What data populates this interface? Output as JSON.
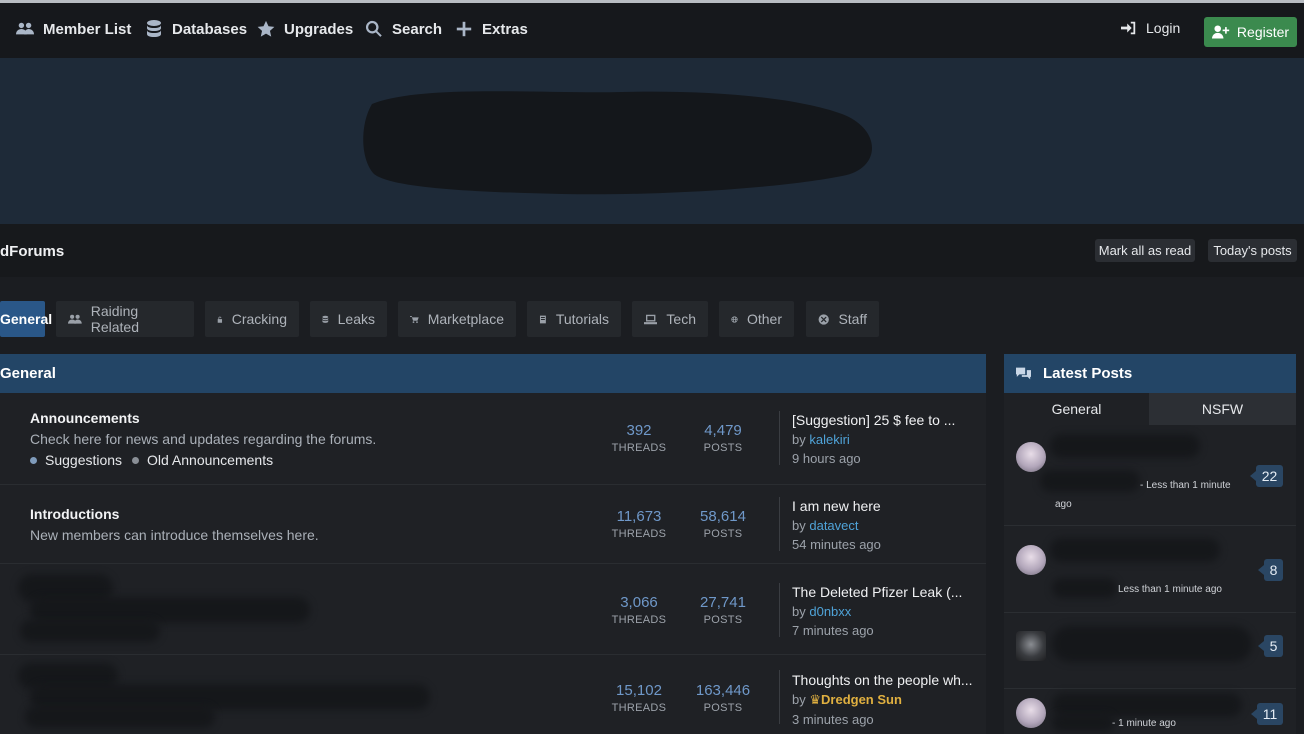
{
  "nav": {
    "items": [
      {
        "label": "Member List",
        "icon": "users-icon"
      },
      {
        "label": "Databases",
        "icon": "database-icon"
      },
      {
        "label": "Upgrades",
        "icon": "star-icon"
      },
      {
        "label": "Search",
        "icon": "search-icon"
      },
      {
        "label": "Extras",
        "icon": "plus-icon"
      }
    ],
    "login_label": "Login",
    "register_label": "Register"
  },
  "breadcrumb": {
    "title": "dForums",
    "mark_read_label": "Mark all as read",
    "todays_posts_label": "Today's posts"
  },
  "category_tabs": [
    {
      "label": "General",
      "icon": "",
      "active": true
    },
    {
      "label": "Raiding Related",
      "icon": "users-icon"
    },
    {
      "label": "Cracking",
      "icon": "lock-icon"
    },
    {
      "label": "Leaks",
      "icon": "database-icon"
    },
    {
      "label": "Marketplace",
      "icon": "cart-icon"
    },
    {
      "label": "Tutorials",
      "icon": "book-icon"
    },
    {
      "label": "Tech",
      "icon": "laptop-icon"
    },
    {
      "label": "Other",
      "icon": "globe-icon"
    },
    {
      "label": "Staff",
      "icon": "circle-x-icon"
    }
  ],
  "section": {
    "title": "General",
    "forums": [
      {
        "title": "Announcements",
        "description": "Check here for news and updates regarding the forums.",
        "subforums": [
          "Suggestions",
          "Old Announcements"
        ],
        "threads": "392",
        "posts": "4,479",
        "last_title": "[Suggestion] 25 $ fee to ...",
        "last_by_prefix": "by",
        "last_author": "kalekiri",
        "last_time": "9 hours ago"
      },
      {
        "title": "Introductions",
        "description": "New members can introduce themselves here.",
        "threads": "11,673",
        "posts": "58,614",
        "last_title": "I am new here",
        "last_by_prefix": "by",
        "last_author": "datavect",
        "last_time": "54 minutes ago"
      },
      {
        "threads": "3,066",
        "posts": "27,741",
        "last_title": "The Deleted Pfizer Leak (...",
        "last_by_prefix": "by",
        "last_author": "d0nbxx",
        "last_time": "7 minutes ago"
      },
      {
        "threads": "15,102",
        "posts": "163,446",
        "last_title": "Thoughts on the people wh...",
        "last_by_prefix": "by",
        "last_author": "Dredgen Sun",
        "last_time": "3 minutes ago"
      }
    ],
    "threads_label": "THREADS",
    "posts_label": "POSTS"
  },
  "latest_posts": {
    "title": "Latest Posts",
    "tabs": [
      "General",
      "NSFW"
    ],
    "items": [
      {
        "meta": "- Less than 1 minute",
        "meta2": "ago",
        "count": "22"
      },
      {
        "meta": "Less than 1 minute ago",
        "count": "8"
      },
      {
        "meta": "",
        "count": "5"
      },
      {
        "meta": "- 1 minute ago",
        "count": "11"
      }
    ]
  },
  "colors": {
    "accent": "#234566",
    "active_tab": "#2a5788",
    "register": "#3b8a4e",
    "link": "#4fa3d8",
    "number": "#6f98c9"
  }
}
